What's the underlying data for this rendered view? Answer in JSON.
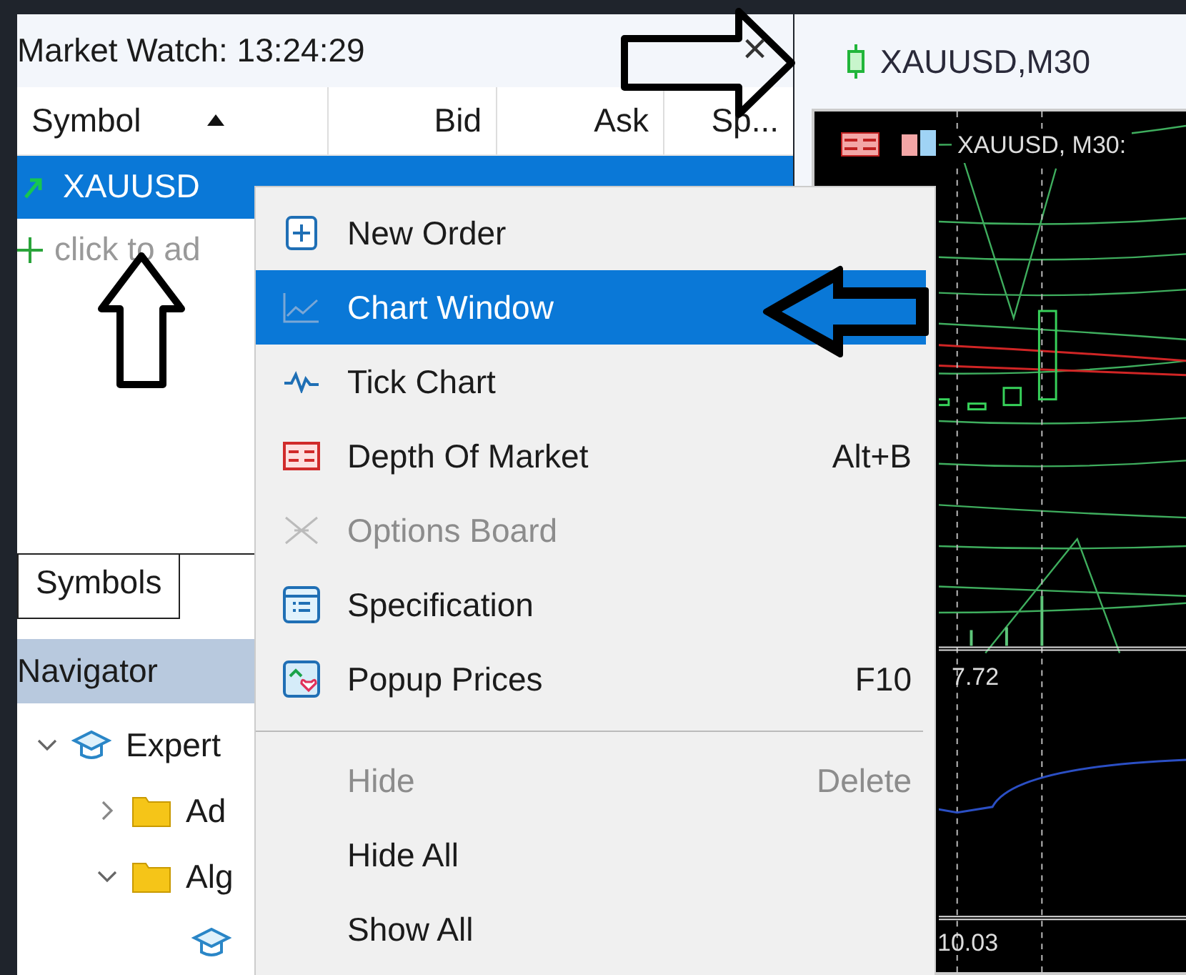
{
  "market_watch": {
    "title": "Market Watch: 13:24:29",
    "close": "×",
    "columns": [
      {
        "label": "Symbol",
        "sorted": true
      },
      {
        "label": "Bid",
        "sorted": false
      },
      {
        "label": "Ask",
        "sorted": false
      },
      {
        "label": "Sp...",
        "sorted": false
      }
    ],
    "rows": [
      {
        "symbol": "XAUUSD",
        "selected": true
      }
    ],
    "add_row": "click to ad",
    "tabs": [
      {
        "label": "Symbols",
        "selected": true
      }
    ]
  },
  "navigator": {
    "title": "Navigator",
    "tree": [
      {
        "kind": "expert",
        "label": "Expert",
        "expanded": true,
        "children": [
          {
            "kind": "folder",
            "label": "Ad",
            "expanded": false
          },
          {
            "kind": "folder",
            "label": "Alg",
            "expanded": true,
            "children": [
              {
                "kind": "expert"
              }
            ]
          }
        ]
      }
    ]
  },
  "chart_window": {
    "title": "XAUUSD,M30",
    "chart_label": "XAUUSD, M30:",
    "indicator_value": "7.72",
    "lower_value": "10.03"
  },
  "context_menu": [
    {
      "kind": "order",
      "label": "New Order",
      "selected": false,
      "disabled": false
    },
    {
      "kind": "chart",
      "label": "Chart Window",
      "selected": true,
      "disabled": false
    },
    {
      "kind": "tick",
      "label": "Tick Chart",
      "selected": false,
      "disabled": false
    },
    {
      "kind": "depth",
      "label": "Depth Of Market",
      "shortcut": "Alt+B",
      "selected": false,
      "disabled": false
    },
    {
      "kind": "options",
      "label": "Options Board",
      "selected": false,
      "disabled": true
    },
    {
      "kind": "spec",
      "label": "Specification",
      "selected": false,
      "disabled": false
    },
    {
      "kind": "popup",
      "label": "Popup Prices",
      "shortcut": "F10",
      "selected": false,
      "disabled": false
    },
    {
      "kind": "separator"
    },
    {
      "kind": "plain",
      "label": "Hide",
      "shortcut": "Delete",
      "selected": false,
      "disabled": true
    },
    {
      "kind": "plain",
      "label": "Hide All",
      "selected": false,
      "disabled": false
    },
    {
      "kind": "plain",
      "label": "Show All",
      "selected": false,
      "disabled": false
    }
  ]
}
